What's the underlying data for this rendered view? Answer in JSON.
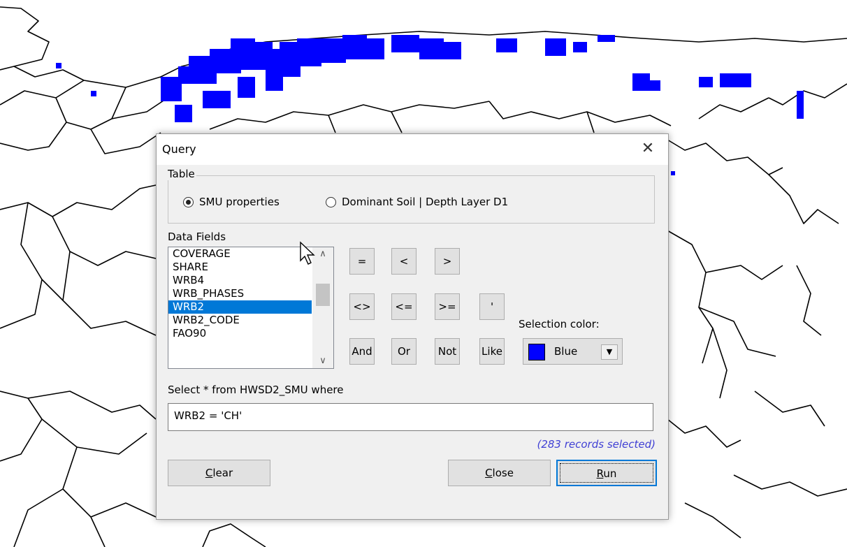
{
  "dialog": {
    "title": "Query",
    "close_glyph": "✕",
    "table_group": {
      "legend": "Table",
      "options": [
        {
          "label": "SMU properties",
          "checked": true
        },
        {
          "label": "Dominant Soil | Depth Layer D1",
          "checked": false
        }
      ]
    },
    "fields": {
      "label": "Data Fields",
      "items": [
        "COVERAGE",
        "SHARE",
        "WRB4",
        "WRB_PHASES",
        "WRB2",
        "WRB2_CODE",
        "FAO90"
      ],
      "selected": "WRB2"
    },
    "operators": {
      "eq": "=",
      "lt": "<",
      "gt": ">",
      "ne": "<>",
      "le": "<=",
      "ge": ">=",
      "quote": "'",
      "and": "And",
      "or": "Or",
      "not": "Not",
      "like": "Like"
    },
    "selection_color": {
      "label": "Selection color:",
      "value": "Blue",
      "swatch_color": "#0000ff"
    },
    "sql_prefix": "Select * from HWSD2_SMU where",
    "query_text": "WRB2  = 'CH'",
    "status": "(283 records selected)",
    "buttons": {
      "clear": {
        "first": "C",
        "rest": "lear"
      },
      "close": {
        "first": "C",
        "rest": "lose"
      },
      "run": {
        "first": "R",
        "rest": "un"
      }
    }
  },
  "colors": {
    "selected_soil_highlight": "#0000ff",
    "list_selection": "#0078d7",
    "status_text": "#3f3fd4"
  }
}
